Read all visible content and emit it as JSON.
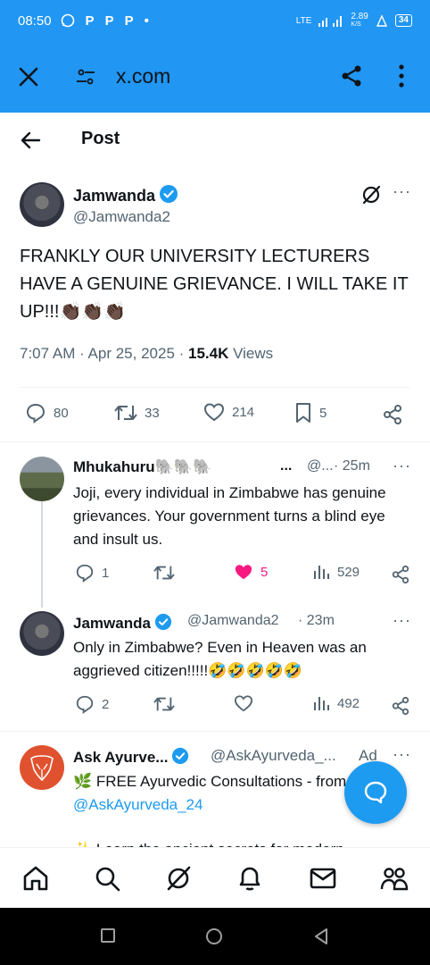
{
  "status_bar": {
    "time": "08:50",
    "app_icons": [
      "whatsapp-icon",
      "P",
      "P",
      "P",
      "•"
    ],
    "network": "LTE",
    "speed": "2.89",
    "speed_unit": "K/S",
    "battery": "34"
  },
  "browser": {
    "url": "x.com"
  },
  "header": {
    "title": "Post"
  },
  "post": {
    "name": "Jamwanda",
    "handle": "@Jamwanda2",
    "text": "FRANKLY OUR UNIVERSITY LECTURERS HAVE A GENUINE GRIEVANCE. I WILL TAKE IT UP!!!👏🏿👏🏿👏🏿",
    "time": "7:07 AM · Apr 25, 2025 · ",
    "views_count": "15.4K",
    "views_label": " Views",
    "replies": "80",
    "reposts": "33",
    "likes": "214",
    "bookmarks": "5"
  },
  "replies": [
    {
      "name": "Mhukahuru🐘🐘🐘",
      "handle": "@...",
      "time": "· 25m",
      "text": "Joji, every individual in Zimbabwe has genuine grievances. Your government turns a blind eye and insult us.",
      "replies": "1",
      "likes": "5",
      "views": "529"
    },
    {
      "name": "Jamwanda",
      "handle": "@Jamwanda2",
      "time": "· 23m",
      "text": "Only in Zimbabwe? Even in Heaven was an aggrieved citizen!!!!!🤣🤣🤣🤣🤣",
      "replies": "2",
      "views": "492"
    }
  ],
  "ad": {
    "name": "Ask Ayurve...",
    "handle": "@AskAyurveda_...",
    "tag": "Ad",
    "text_prefix": "🌿 FREE Ayurvedic Consultations - from ",
    "link": "@AskAyurveda_24",
    "text2": "✨ Learn the ancient secrets for modern"
  },
  "colors": {
    "accent": "#1d9bf0",
    "like": "#f91880",
    "browser_bar": "#2196f3"
  }
}
